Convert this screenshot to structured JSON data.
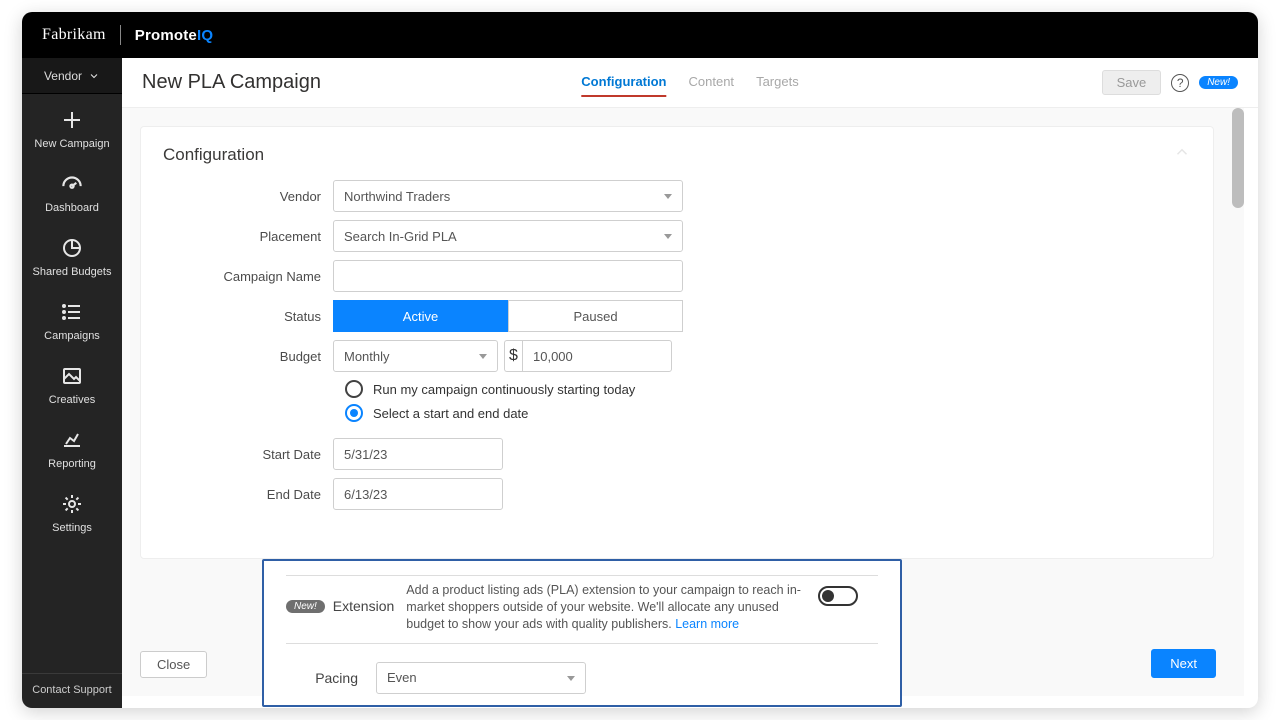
{
  "brand": {
    "left": "Fabrikam",
    "right_a": "Promote",
    "right_b": "IQ"
  },
  "vendor_menu": "Vendor",
  "nav": {
    "new_campaign": "New Campaign",
    "dashboard": "Dashboard",
    "shared_budgets": "Shared Budgets",
    "campaigns": "Campaigns",
    "creatives": "Creatives",
    "reporting": "Reporting",
    "settings": "Settings",
    "contact": "Contact Support"
  },
  "header": {
    "title": "New PLA Campaign",
    "tabs": {
      "configuration": "Configuration",
      "content": "Content",
      "targets": "Targets"
    },
    "save": "Save",
    "help_q": "?",
    "new_pill": "New!"
  },
  "section": {
    "title": "Configuration",
    "labels": {
      "vendor": "Vendor",
      "placement": "Placement",
      "campaign_name": "Campaign Name",
      "status": "Status",
      "budget": "Budget",
      "start_date": "Start Date",
      "end_date": "End Date"
    },
    "values": {
      "vendor": "Northwind Traders",
      "placement": "Search In-Grid PLA",
      "campaign_name": "",
      "status_active": "Active",
      "status_paused": "Paused",
      "budget_period": "Monthly",
      "currency": "$",
      "budget_amount": "10,000",
      "radio_continuous": "Run my campaign continuously starting today",
      "radio_dates": "Select a start and end date",
      "start_date": "5/31/23",
      "end_date": "6/13/23"
    }
  },
  "extension": {
    "new_badge": "New!",
    "label": "Extension",
    "text": "Add a product listing ads (PLA) extension to your campaign to reach in-market shoppers outside of your website. We'll allocate any unused budget to show your ads with quality publishers.",
    "learn": "Learn more",
    "pacing_label": "Pacing",
    "pacing_value": "Even"
  },
  "footer": {
    "close": "Close",
    "next": "Next"
  }
}
